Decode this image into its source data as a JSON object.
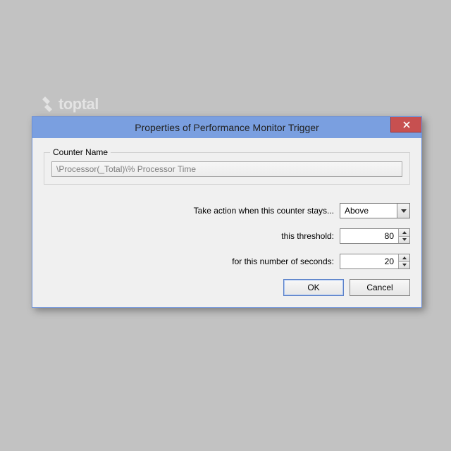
{
  "logo": {
    "text": "toptal"
  },
  "dialog": {
    "title": "Properties of Performance Monitor Trigger",
    "counter_group_label": "Counter Name",
    "counter_name": "\\Processor(_Total)\\% Processor Time",
    "action_label": "Take action when this counter stays...",
    "condition_value": "Above",
    "threshold_label": "this threshold:",
    "threshold_value": "80",
    "seconds_label": "for this number of seconds:",
    "seconds_value": "20",
    "ok_label": "OK",
    "cancel_label": "Cancel"
  }
}
